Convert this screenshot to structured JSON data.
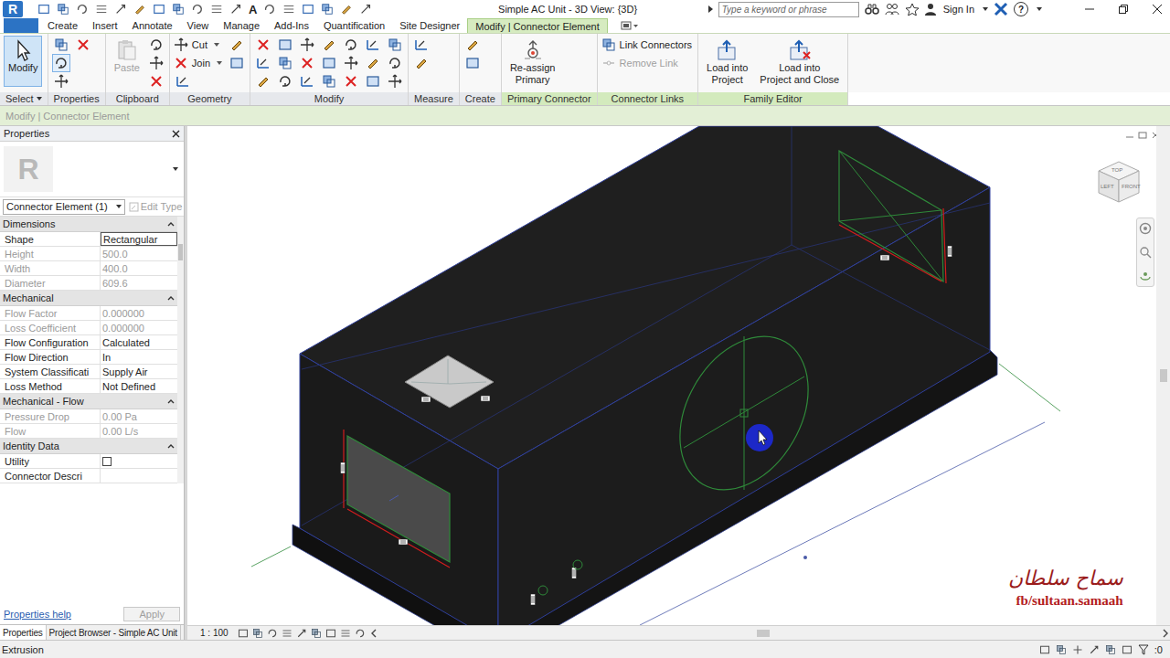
{
  "title_bar": {
    "app_logo": "R",
    "qat_text_tool": "A",
    "title": "Simple AC Unit - 3D View: {3D}",
    "search_placeholder": "Type a keyword or phrase",
    "sign_in": "Sign In",
    "help": "?"
  },
  "ribbon_tabs": [
    {
      "label": "Create",
      "selected": false
    },
    {
      "label": "Insert",
      "selected": false
    },
    {
      "label": "Annotate",
      "selected": false
    },
    {
      "label": "View",
      "selected": false
    },
    {
      "label": "Manage",
      "selected": false
    },
    {
      "label": "Add-Ins",
      "selected": false
    },
    {
      "label": "Quantification",
      "selected": false
    },
    {
      "label": "Site Designer",
      "selected": false
    },
    {
      "label": "Modify | Connector Element",
      "selected": true
    }
  ],
  "ribbon_panels": [
    {
      "label": "Select",
      "dropdown": true,
      "contextual": false,
      "buttons": [
        {
          "kind": "large",
          "lines": [
            "Modify"
          ],
          "selected": true,
          "disabled": false
        }
      ]
    },
    {
      "label": "Properties",
      "dropdown": false,
      "contextual": false,
      "buttons": [
        {
          "kind": "icon",
          "selected": false,
          "disabled": false
        },
        {
          "kind": "icon",
          "selected": true,
          "disabled": false
        },
        {
          "kind": "icon",
          "selected": false,
          "disabled": false
        },
        {
          "kind": "icon",
          "selected": false,
          "disabled": false
        }
      ]
    },
    {
      "label": "Clipboard",
      "dropdown": false,
      "contextual": false,
      "buttons": [
        {
          "kind": "large",
          "lines": [
            "Paste"
          ],
          "selected": false,
          "disabled": true
        },
        {
          "kind": "icon",
          "selected": false,
          "disabled": false
        },
        {
          "kind": "icon",
          "selected": false,
          "disabled": false
        },
        {
          "kind": "icon",
          "selected": false,
          "disabled": false
        }
      ]
    },
    {
      "label": "Geometry",
      "dropdown": false,
      "contextual": false,
      "buttons": [
        {
          "kind": "small",
          "label": "Cut",
          "selected": false,
          "disabled": false
        },
        {
          "kind": "small",
          "label": "Join",
          "selected": false,
          "disabled": false
        },
        {
          "kind": "icon",
          "selected": false,
          "disabled": false
        },
        {
          "kind": "icon",
          "selected": false,
          "disabled": false
        },
        {
          "kind": "icon",
          "selected": false,
          "disabled": false
        }
      ]
    },
    {
      "label": "Modify",
      "dropdown": false,
      "contextual": false,
      "buttons": [
        {
          "kind": "icon",
          "selected": false,
          "disabled": false
        },
        {
          "kind": "icon",
          "selected": false,
          "disabled": false
        },
        {
          "kind": "icon",
          "selected": false,
          "disabled": false
        },
        {
          "kind": "icon",
          "selected": false,
          "disabled": false
        },
        {
          "kind": "icon",
          "selected": false,
          "disabled": false
        },
        {
          "kind": "icon",
          "selected": false,
          "disabled": false
        },
        {
          "kind": "icon",
          "selected": false,
          "disabled": false
        },
        {
          "kind": "icon",
          "selected": false,
          "disabled": false
        },
        {
          "kind": "icon",
          "selected": false,
          "disabled": false
        },
        {
          "kind": "icon",
          "selected": false,
          "disabled": false
        },
        {
          "kind": "icon",
          "selected": false,
          "disabled": false
        },
        {
          "kind": "icon",
          "selected": false,
          "disabled": false
        },
        {
          "kind": "icon",
          "selected": false,
          "disabled": false
        },
        {
          "kind": "icon",
          "selected": false,
          "disabled": false
        },
        {
          "kind": "icon",
          "selected": false,
          "disabled": false
        },
        {
          "kind": "icon",
          "selected": false,
          "disabled": false
        },
        {
          "kind": "icon",
          "selected": false,
          "disabled": false
        },
        {
          "kind": "icon",
          "selected": false,
          "disabled": false
        },
        {
          "kind": "icon",
          "selected": false,
          "disabled": false
        },
        {
          "kind": "icon",
          "selected": false,
          "disabled": false
        },
        {
          "kind": "icon",
          "selected": false,
          "disabled": false
        }
      ]
    },
    {
      "label": "Measure",
      "dropdown": false,
      "contextual": false,
      "buttons": [
        {
          "kind": "icon",
          "selected": false,
          "disabled": false
        },
        {
          "kind": "icon",
          "selected": false,
          "disabled": false
        }
      ]
    },
    {
      "label": "Create",
      "dropdown": false,
      "contextual": false,
      "buttons": [
        {
          "kind": "icon",
          "selected": false,
          "disabled": false
        },
        {
          "kind": "icon",
          "selected": false,
          "disabled": false
        }
      ]
    },
    {
      "label": "Primary Connector",
      "dropdown": false,
      "contextual": true,
      "buttons": [
        {
          "kind": "large",
          "lines": [
            "Re-assign",
            "Primary"
          ],
          "selected": false,
          "disabled": false
        }
      ]
    },
    {
      "label": "Connector Links",
      "dropdown": false,
      "contextual": true,
      "buttons": [
        {
          "kind": "small",
          "label": "Link Connectors",
          "selected": false,
          "disabled": false
        },
        {
          "kind": "small",
          "label": "Remove Link",
          "selected": false,
          "disabled": true
        }
      ]
    },
    {
      "label": "Family Editor",
      "dropdown": false,
      "contextual": true,
      "buttons": [
        {
          "kind": "large",
          "lines": [
            "Load into",
            "Project"
          ],
          "selected": false,
          "disabled": false
        },
        {
          "kind": "large",
          "lines": [
            "Load into",
            "Project and Close"
          ],
          "selected": false,
          "disabled": false
        }
      ]
    }
  ],
  "options_bar": {
    "text": "Modify | Connector Element",
    "disabled": true
  },
  "properties": {
    "title": "Properties",
    "type_image_logo": "R",
    "type_name": "Connector Element (1)",
    "edit_type": {
      "label": "Edit Type",
      "disabled": true
    },
    "groups": [
      {
        "label": "Dimensions",
        "rows": [
          {
            "label": "Shape",
            "kind": "text",
            "value": "Rectangular",
            "selected": true,
            "disabled": false
          },
          {
            "label": "Height",
            "kind": "text",
            "value": "500.0",
            "selected": false,
            "disabled": true
          },
          {
            "label": "Width",
            "kind": "text",
            "value": "400.0",
            "selected": false,
            "disabled": true
          },
          {
            "label": "Diameter",
            "kind": "text",
            "value": "609.6",
            "selected": false,
            "disabled": true
          }
        ]
      },
      {
        "label": "Mechanical",
        "rows": [
          {
            "label": "Flow Factor",
            "kind": "text",
            "value": "0.000000",
            "selected": false,
            "disabled": true
          },
          {
            "label": "Loss Coefficient",
            "kind": "text",
            "value": "0.000000",
            "selected": false,
            "disabled": true
          },
          {
            "label": "Flow Configuration",
            "kind": "text",
            "value": "Calculated",
            "selected": false,
            "disabled": false
          },
          {
            "label": "Flow Direction",
            "kind": "text",
            "value": "In",
            "selected": false,
            "disabled": false
          },
          {
            "label": "System Classificati",
            "kind": "text",
            "value": "Supply Air",
            "selected": false,
            "disabled": false
          },
          {
            "label": "Loss Method",
            "kind": "text",
            "value": "Not Defined",
            "selected": false,
            "disabled": false
          }
        ]
      },
      {
        "label": "Mechanical - Flow",
        "rows": [
          {
            "label": "Pressure Drop",
            "kind": "text",
            "value": "0.00 Pa",
            "selected": false,
            "disabled": true
          },
          {
            "label": "Flow",
            "kind": "text",
            "value": "0.00 L/s",
            "selected": false,
            "disabled": true
          }
        ]
      },
      {
        "label": "Identity Data",
        "rows": [
          {
            "label": "Utility",
            "kind": "checkbox",
            "checked": false,
            "selected": false,
            "disabled": false
          },
          {
            "label": "Connector Descri",
            "kind": "text",
            "value": "",
            "selected": false,
            "disabled": false
          }
        ]
      }
    ],
    "help_link": "Properties help",
    "apply": {
      "label": "Apply",
      "disabled": true
    },
    "bottom_tabs": [
      {
        "label": "Properties",
        "selected": true
      },
      {
        "label": "Project Browser - Simple AC Unit",
        "selected": false
      }
    ]
  },
  "view_cube": {
    "top": "TOP",
    "left": "LEFT",
    "front": "FRONT"
  },
  "watermark": {
    "name": "سماح سلطان",
    "link": "fb/sultaan.samaah"
  },
  "view_bar": {
    "scale": "1 : 100"
  },
  "status_bar": {
    "text": "Extrusion",
    "filter_count": ":0"
  }
}
